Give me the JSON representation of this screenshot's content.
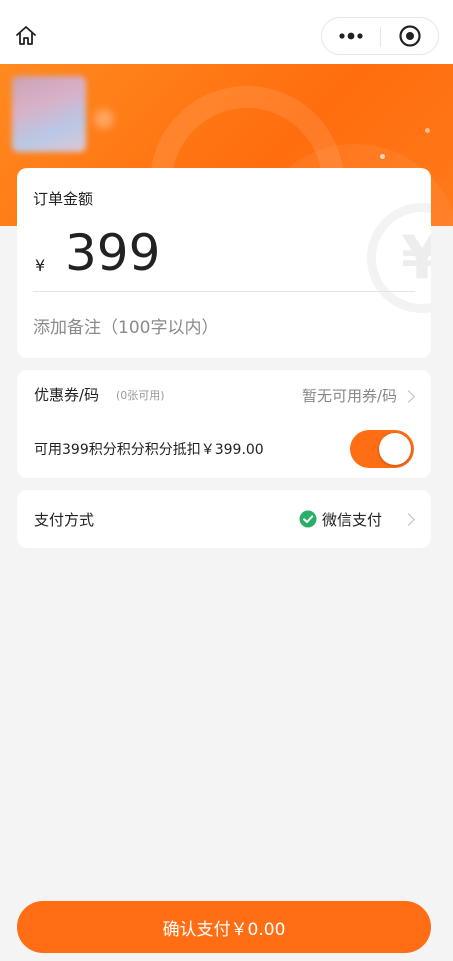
{
  "topbar": {
    "home_icon": "home-icon",
    "more_icon": "more-dots-icon",
    "close_icon": "close-target-icon"
  },
  "banner": {
    "brand_color": "#ff6d0e"
  },
  "order": {
    "amount_label": "订单金额",
    "currency_symbol": "¥",
    "amount": "399",
    "remark_placeholder": "添加备注（100字以内）"
  },
  "discount": {
    "coupon_label": "优惠券/码",
    "coupon_count": "(0张可用)",
    "coupon_value": "暂无可用券/码",
    "points_label": "可用399积分积分积分抵扣￥399.00",
    "points_toggle_on": true
  },
  "payment": {
    "label": "支付方式",
    "method": "微信支付",
    "method_icon": "wechat-pay-icon"
  },
  "confirm": {
    "label": "确认支付￥0.00"
  },
  "colors": {
    "accent": "#ff6e14",
    "background": "#f4f4f5",
    "wechat_green": "#2aae67"
  }
}
